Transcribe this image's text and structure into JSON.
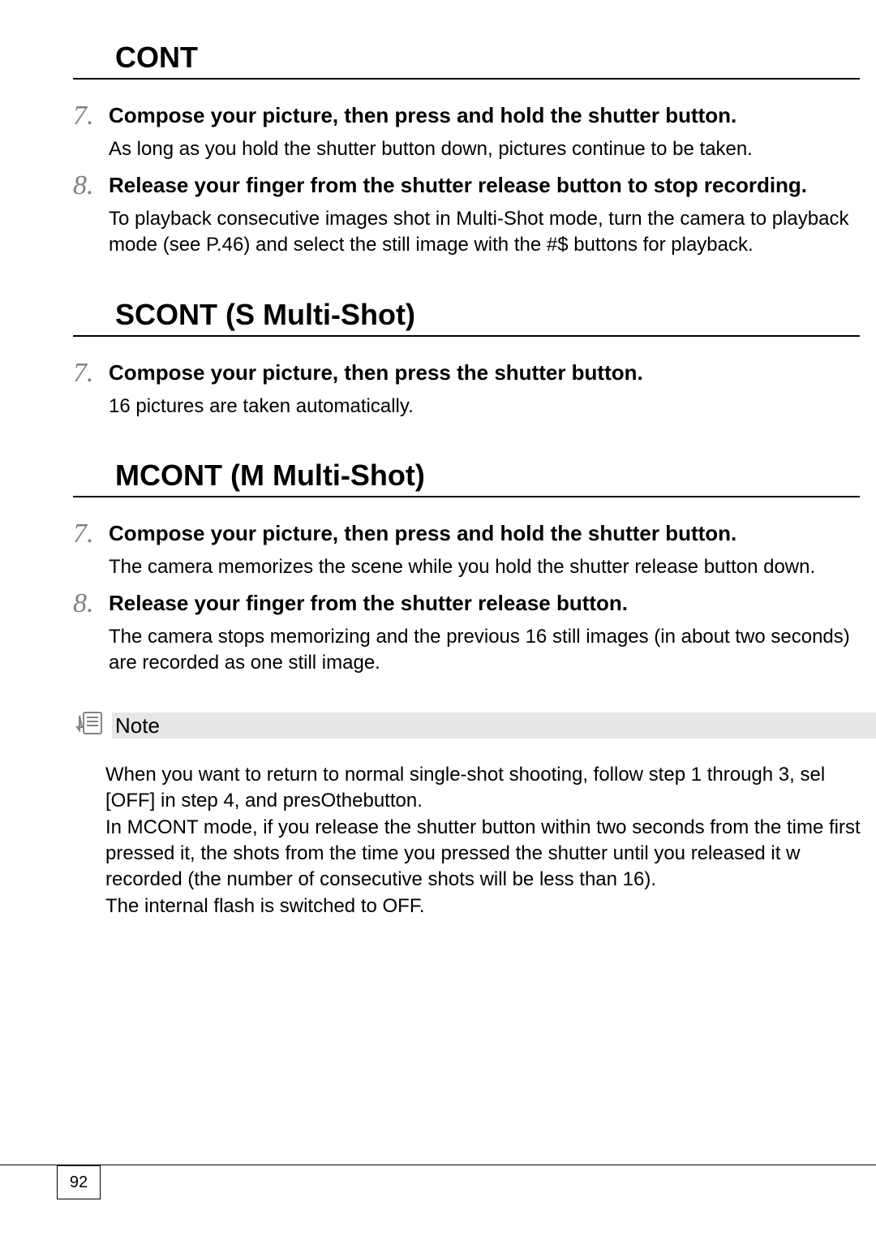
{
  "sections": {
    "cont": {
      "title": "CONT",
      "step7_num": "7.",
      "step7_head": "Compose your picture, then press and hold the shutter button.",
      "step7_desc": "As long as you hold the shutter button down, pictures continue to be taken.",
      "step8_num": "8.",
      "step8_head": "Release your finger from the shutter release button to stop recording.",
      "step8_desc": "To playback consecutive images shot in Multi-Shot mode, turn the camera to playback mode (see P.46) and select the still image with the #$ buttons for playback."
    },
    "scont": {
      "title": "SCONT (S Multi-Shot)",
      "step7_num": "7.",
      "step7_head": "Compose your picture, then press the shutter button.",
      "step7_desc": "16 pictures are taken automatically."
    },
    "mcont": {
      "title": "MCONT (M Multi-Shot)",
      "step7_num": "7.",
      "step7_head": "Compose your picture, then press and hold the shutter button.",
      "step7_desc": "The camera memorizes the scene while you hold the shutter release button down.",
      "step8_num": "8.",
      "step8_head": "Release your finger from the shutter release button.",
      "step8_desc": "The camera stops memorizing and the previous 16 still images (in about two seconds) are recorded as one still image."
    }
  },
  "note": {
    "label": "Note",
    "body": "When you want to return to normal single-shot shooting, follow step 1 through 3, sel [OFF] in step 4, and presOthebutton.\nIn MCONT mode, if you release the shutter button within two seconds from the time first pressed it, the shots from the time you pressed the shutter until you released it w recorded (the number of consecutive shots will be less than 16).\nThe internal flash is switched to OFF."
  },
  "page_number": "92"
}
